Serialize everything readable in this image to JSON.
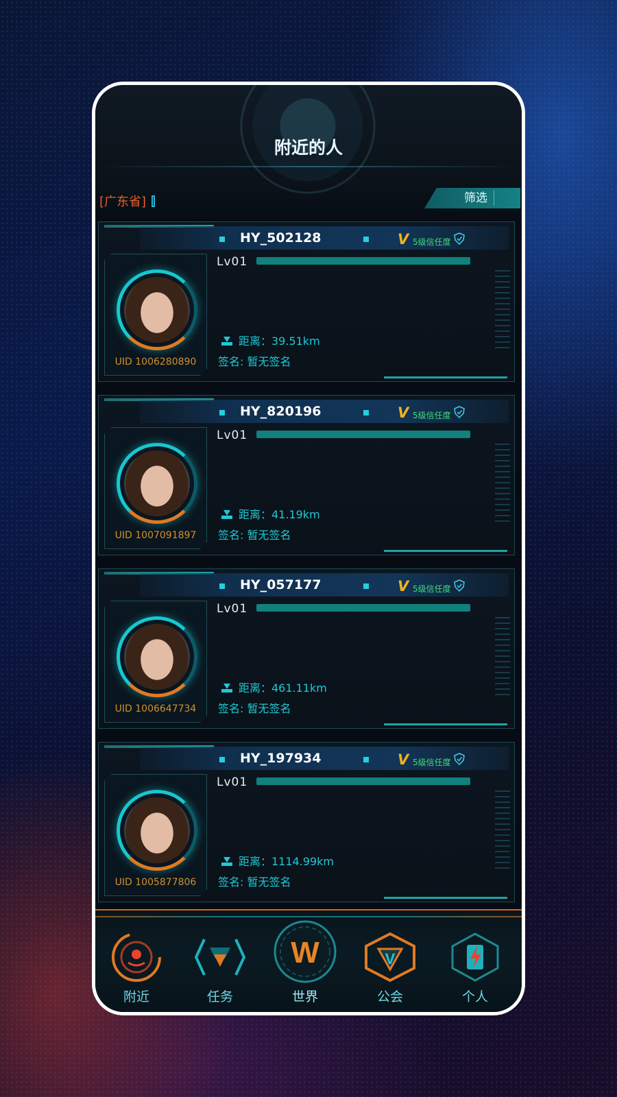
{
  "header": {
    "title": "附近的人",
    "region": "[广东省]",
    "filter_label": "筛选"
  },
  "cards": [
    {
      "name": "HY_502128",
      "vip": "V",
      "trust": "5级信任度",
      "level": "Lv01",
      "distance": "距离：39.51km",
      "signature": "签名: 暂无签名",
      "uid": "UID 1006280890"
    },
    {
      "name": "HY_820196",
      "vip": "V",
      "trust": "5级信任度",
      "level": "Lv01",
      "distance": "距离：41.19km",
      "signature": "签名: 暂无签名",
      "uid": "UID 1007091897"
    },
    {
      "name": "HY_057177",
      "vip": "V",
      "trust": "5级信任度",
      "level": "Lv01",
      "distance": "距离：461.11km",
      "signature": "签名: 暂无签名",
      "uid": "UID 1006647734"
    },
    {
      "name": "HY_197934",
      "vip": "V",
      "trust": "5级信任度",
      "level": "Lv01",
      "distance": "距离：1114.99km",
      "signature": "签名: 暂无签名",
      "uid": "UID 1005877806"
    }
  ],
  "nav": {
    "items": [
      {
        "label": "附近",
        "icon": "radar-icon"
      },
      {
        "label": "任务",
        "icon": "task-icon"
      },
      {
        "label": "世界",
        "icon": "world-w-icon"
      },
      {
        "label": "公会",
        "icon": "guild-v-icon"
      },
      {
        "label": "个人",
        "icon": "profile-bolt-icon"
      }
    ],
    "world_glyph": "W",
    "guild_glyph": "V"
  },
  "colors": {
    "accent_cyan": "#1fc9d5",
    "accent_orange": "#e07a22",
    "trust_green": "#3fdc7a",
    "vip_gold": "#f0b21e"
  }
}
